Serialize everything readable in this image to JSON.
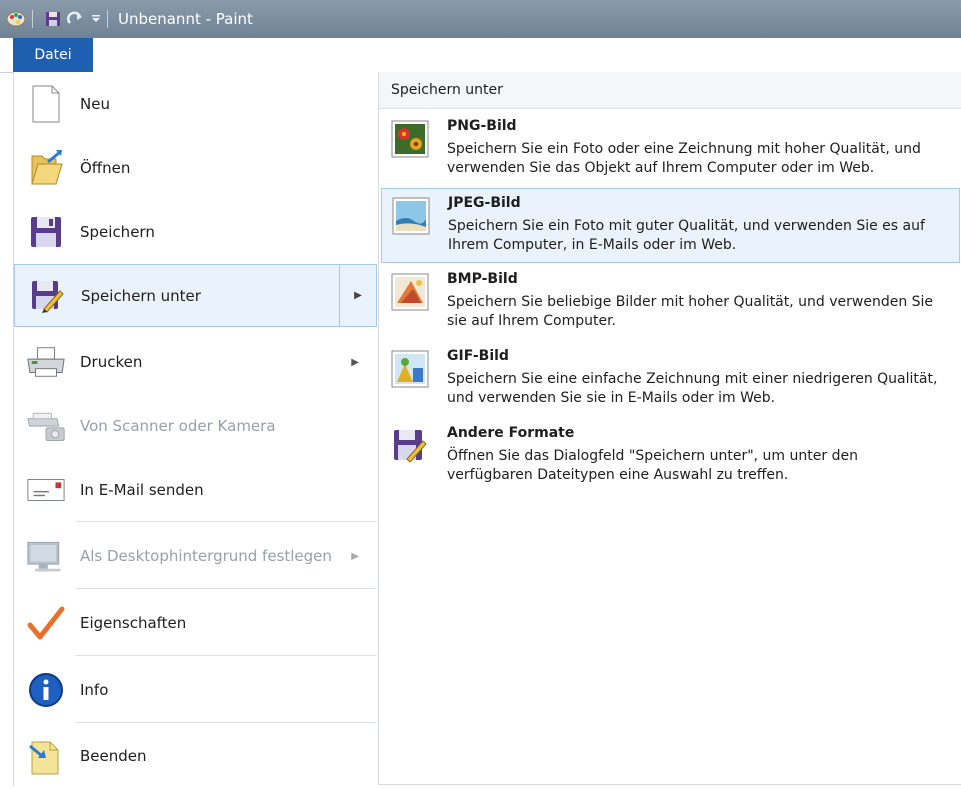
{
  "window": {
    "title": "Unbenannt - Paint"
  },
  "ribbon": {
    "file_tab": "Datei"
  },
  "menu": {
    "items": [
      {
        "label": "Neu",
        "icon": "new-document-icon"
      },
      {
        "label": "Öffnen",
        "icon": "open-folder-icon"
      },
      {
        "label": "Speichern",
        "icon": "save-icon"
      },
      {
        "label": "Speichern unter",
        "icon": "save-as-icon"
      },
      {
        "label": "Drucken",
        "icon": "printer-icon"
      },
      {
        "label": "Von Scanner oder Kamera",
        "icon": "scanner-camera-icon"
      },
      {
        "label": "In E-Mail senden",
        "icon": "email-icon"
      },
      {
        "label": "Als Desktophintergrund festlegen",
        "icon": "desktop-background-icon"
      },
      {
        "label": "Eigenschaften",
        "icon": "properties-check-icon"
      },
      {
        "label": "Info",
        "icon": "info-icon"
      },
      {
        "label": "Beenden",
        "icon": "exit-icon"
      }
    ]
  },
  "save_as_panel": {
    "header": "Speichern unter",
    "formats": [
      {
        "name": "PNG-Bild",
        "description": "Speichern Sie ein Foto oder eine Zeichnung mit hoher Qualität, und verwenden Sie das Objekt auf Ihrem Computer oder im Web.",
        "icon": "png-image-icon"
      },
      {
        "name": "JPEG-Bild",
        "description": "Speichern Sie ein Foto mit guter Qualität, und verwenden Sie es auf Ihrem Computer, in E-Mails oder im Web.",
        "icon": "jpeg-image-icon"
      },
      {
        "name": "BMP-Bild",
        "description": "Speichern Sie beliebige Bilder mit hoher Qualität, und verwenden Sie sie auf Ihrem Computer.",
        "icon": "bmp-image-icon"
      },
      {
        "name": "GIF-Bild",
        "description": "Speichern Sie eine einfache Zeichnung mit einer niedrigeren Qualität, und verwenden Sie sie in E-Mails oder im Web.",
        "icon": "gif-image-icon"
      },
      {
        "name": "Andere Formate",
        "description": "Öffnen Sie das Dialogfeld \"Speichern unter\", um unter den verfügbaren Dateitypen eine Auswahl zu treffen.",
        "icon": "other-formats-icon"
      }
    ]
  },
  "colors": {
    "title_bar": "#6f8294",
    "file_tab": "#1f5fb0",
    "selection_bg": "#eaf2fb",
    "selection_border": "#a9c9ea"
  }
}
